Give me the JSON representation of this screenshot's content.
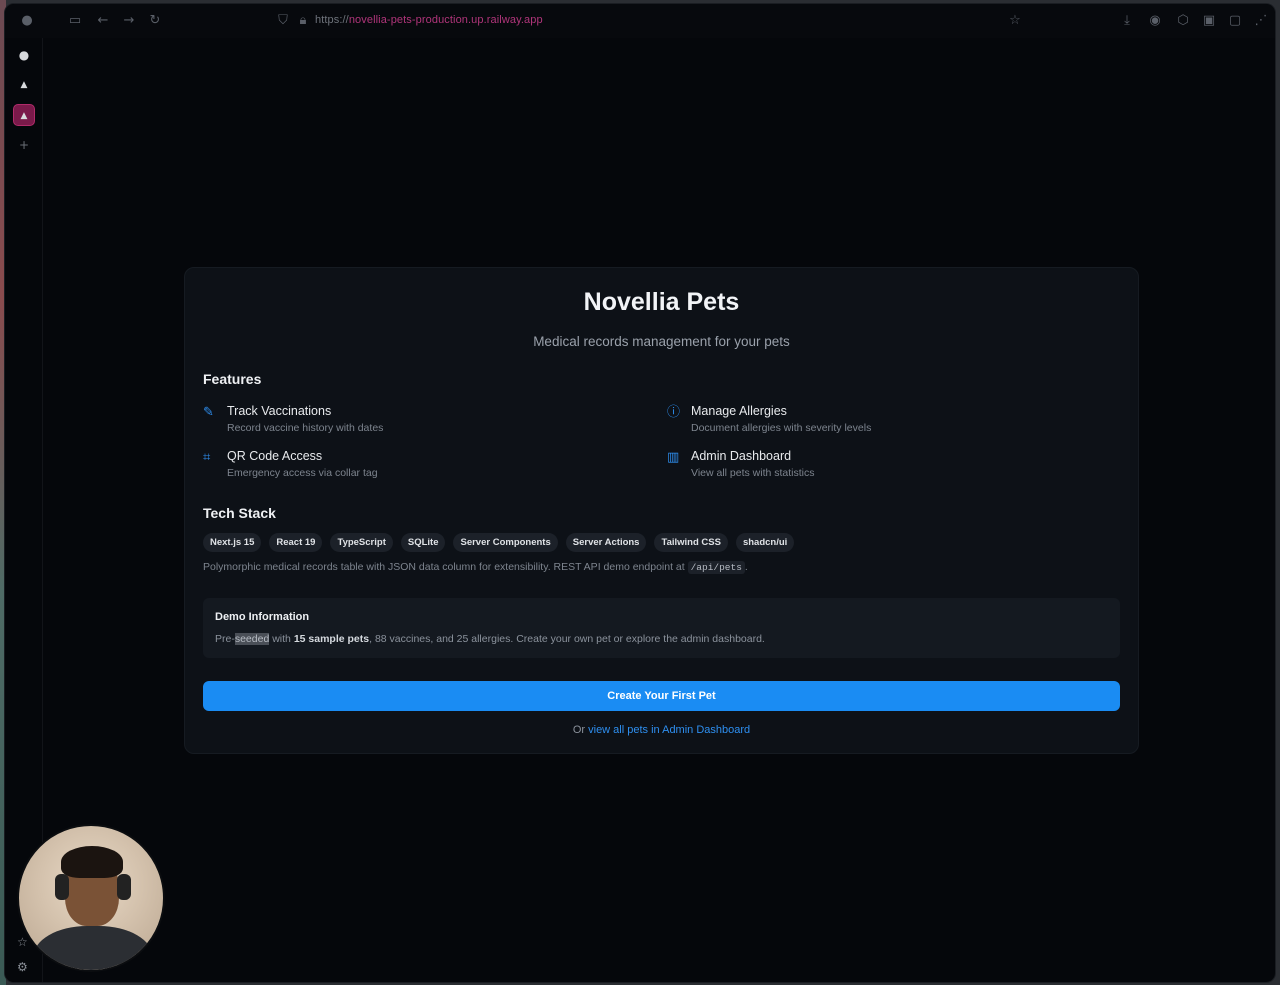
{
  "browser": {
    "url_prefix": "https://",
    "url_host": "novellia-pets-production.up.railway.app",
    "icons": [
      "back-icon",
      "forward-icon",
      "reload-icon",
      "lock-icon",
      "star-icon",
      "download-icon",
      "account-icon",
      "extensions-icon"
    ]
  },
  "sidebar": {
    "items": [
      "github-icon",
      "up-icon",
      "active-tab-icon",
      "add-icon"
    ]
  },
  "card": {
    "title": "Novellia Pets",
    "subtitle": "Medical records management for your pets",
    "features_heading": "Features",
    "features": [
      {
        "icon": "syringe-icon",
        "glyph": "✎",
        "title": "Track Vaccinations",
        "desc": "Record vaccine history with dates"
      },
      {
        "icon": "alert-circle-icon",
        "glyph": "ⓘ",
        "title": "Manage Allergies",
        "desc": "Document allergies with severity levels"
      },
      {
        "icon": "qr-code-icon",
        "glyph": "⌗",
        "title": "QR Code Access",
        "desc": "Emergency access via collar tag"
      },
      {
        "icon": "bar-chart-icon",
        "glyph": "▥",
        "title": "Admin Dashboard",
        "desc": "View all pets with statistics"
      }
    ],
    "tech_heading": "Tech Stack",
    "tech": [
      "Next.js 15",
      "React 19",
      "TypeScript",
      "SQLite",
      "Server Components",
      "Server Actions",
      "Tailwind CSS",
      "shadcn/ui"
    ],
    "tech_desc_pre": "Polymorphic medical records table with JSON data column for extensibility. REST API demo endpoint at ",
    "tech_desc_code": "/api/pets",
    "tech_desc_post": ".",
    "demo": {
      "heading": "Demo Information",
      "t1": "Pre-",
      "t2": "seeded",
      "t3": " with ",
      "t4": "15 sample pets",
      "t5": ", 88 vaccines, and 25 allergies. Create your own pet or explore the admin dashboard."
    },
    "cta": "Create Your First Pet",
    "or_text": "Or ",
    "or_link": "view all pets in Admin Dashboard"
  },
  "colors": {
    "accent": "#1a8cf3",
    "background": "#05070b",
    "card": "#0d1117"
  }
}
